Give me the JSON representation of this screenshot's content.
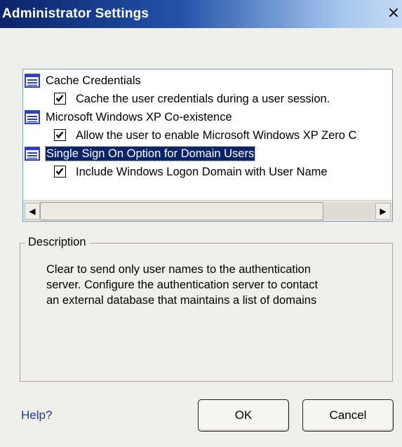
{
  "window": {
    "title": "Administrator Settings",
    "close_glyph": "×"
  },
  "list": {
    "items": [
      {
        "type": "group",
        "icon": "list-icon",
        "label": "Cache Credentials",
        "selected": false
      },
      {
        "type": "option",
        "checked": true,
        "label": "Cache the user credentials during a user session."
      },
      {
        "type": "group",
        "icon": "list-icon",
        "label": "Microsoft Windows XP Co-existence",
        "selected": false
      },
      {
        "type": "option",
        "checked": true,
        "label": "Allow the user to enable Microsoft Windows XP Zero C"
      },
      {
        "type": "group",
        "icon": "list-icon",
        "label": "Single Sign On Option for Domain Users",
        "selected": true
      },
      {
        "type": "option",
        "checked": true,
        "label": "Include Windows Logon Domain with User Name"
      }
    ],
    "scroll_left_glyph": "◀",
    "scroll_right_glyph": "▶"
  },
  "description": {
    "legend": "Description",
    "text": "Clear to send only user names to the authentication\nserver. Configure the authentication server to contact\nan external database that maintains a list of domains"
  },
  "footer": {
    "help_label": "Help?",
    "ok_label": "OK",
    "cancel_label": "Cancel"
  },
  "colors": {
    "title_gradient_start": "#0a246a",
    "selection": "#0a246a",
    "link": "#1a3aa8",
    "icon_blue": "#2f3fbf"
  }
}
